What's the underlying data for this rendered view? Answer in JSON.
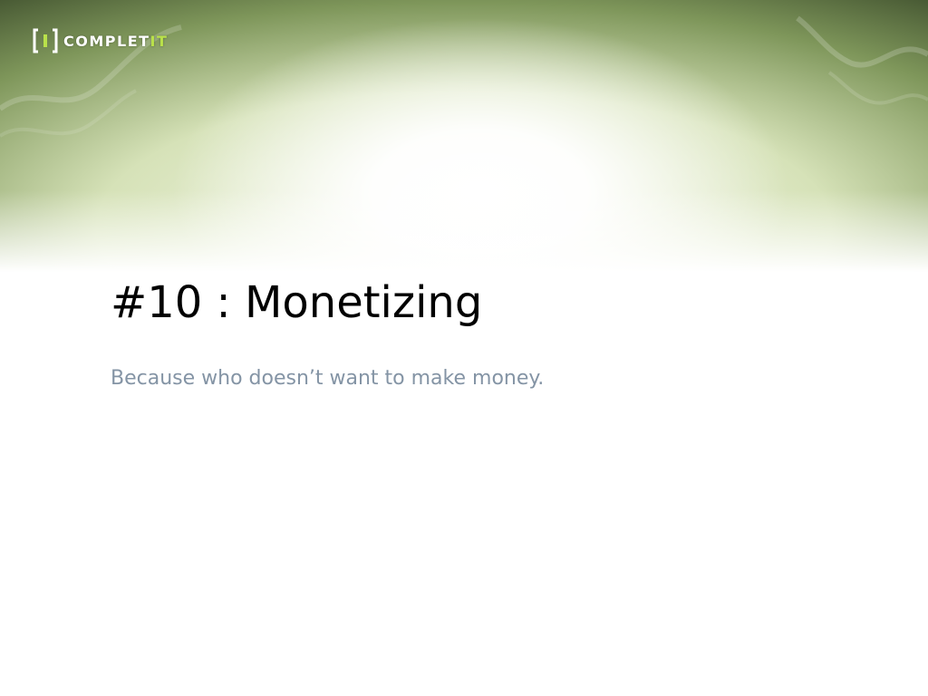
{
  "logo": {
    "text_main": "COMPLET",
    "text_accent": "IT",
    "mark_letter": "I",
    "accent_color": "#b9e14a"
  },
  "slide": {
    "title": "#10 : Monetizing",
    "subtitle": "Because who doesn’t want to make money."
  },
  "colors": {
    "banner_dark": "#3a4a2a",
    "banner_mid": "#7e965a",
    "banner_light": "#d6e2b8",
    "title": "#000000",
    "subtitle": "#8494a5",
    "background": "#ffffff"
  }
}
